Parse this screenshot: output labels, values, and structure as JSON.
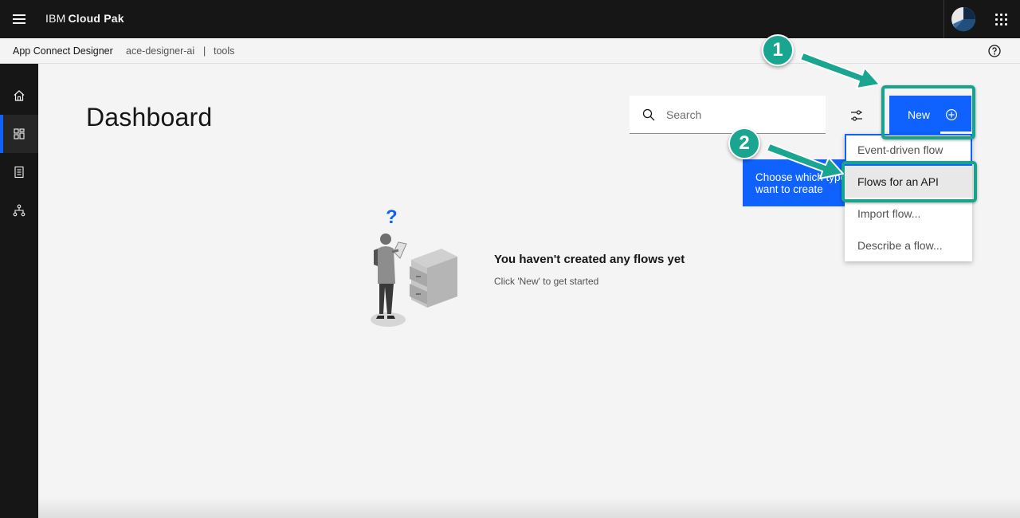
{
  "header": {
    "brand_prefix": "IBM",
    "brand_name": "Cloud Pak"
  },
  "breadcrumb": {
    "app": "App Connect Designer",
    "instance": "ace-designer-ai",
    "separator": "|",
    "namespace": "tools"
  },
  "sidenav": {
    "items": [
      {
        "name": "home",
        "icon": "home-icon",
        "active": false
      },
      {
        "name": "dashboard",
        "icon": "dashboard-icon",
        "active": true
      },
      {
        "name": "catalog",
        "icon": "catalog-icon",
        "active": false
      },
      {
        "name": "flows",
        "icon": "hierarchy-icon",
        "active": false
      }
    ]
  },
  "main": {
    "title": "Dashboard",
    "search": {
      "placeholder": "Search",
      "value": ""
    },
    "new_button": {
      "label": "New"
    },
    "tooltip": {
      "line1": "Choose which type",
      "line2": "want to create"
    },
    "new_menu": {
      "items": [
        "Event-driven flow",
        "Flows for an API",
        "Import flow...",
        "Describe a flow..."
      ],
      "highlighted": "Flows for an API"
    },
    "empty_state": {
      "title": "You haven't created any flows yet",
      "subtitle": "Click 'New' to get started",
      "question_mark": "?"
    }
  },
  "annotations": {
    "badges": [
      "1",
      "2"
    ],
    "color": "#18a48c"
  },
  "colors": {
    "accent": "#0f62fe",
    "header_bg": "#161616",
    "annotation": "#18a48c"
  }
}
